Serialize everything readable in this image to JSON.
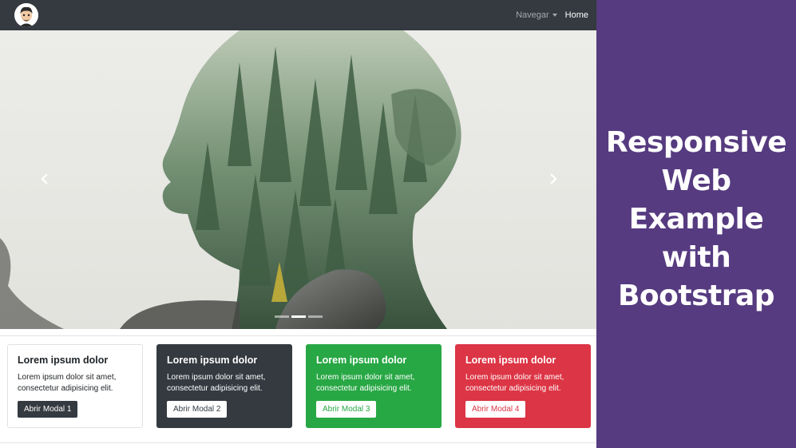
{
  "navbar": {
    "avatar_icon": "cartoon-avatar-icon",
    "dropdown_label": "Navegar",
    "home_label": "Home"
  },
  "carousel": {
    "prev_icon": "chevron-left-icon",
    "next_icon": "chevron-right-icon",
    "slides": 3,
    "active_slide": 2
  },
  "cards": [
    {
      "title": "Lorem ipsum dolor",
      "text": "Lorem ipsum dolor sit amet, consectetur adipisicing elit.",
      "button": "Abrir Modal 1",
      "color": "#ffffff"
    },
    {
      "title": "Lorem ipsum dolor",
      "text": "Lorem ipsum dolor sit amet, consectetur adipisicing elit.",
      "button": "Abrir Modal 2",
      "color": "#343a40"
    },
    {
      "title": "Lorem ipsum dolor",
      "text": "Lorem ipsum dolor sit amet, consectetur adipisicing elit.",
      "button": "Abrir Modal 3",
      "color": "#28a745"
    },
    {
      "title": "Lorem ipsum dolor",
      "text": "Lorem ipsum dolor sit amet, consectetur adipisicing elit.",
      "button": "Abrir Modal 4",
      "color": "#dc3545"
    }
  ],
  "banner": {
    "title": "Responsive Web Example with Bootstrap",
    "background": "#563b80"
  }
}
